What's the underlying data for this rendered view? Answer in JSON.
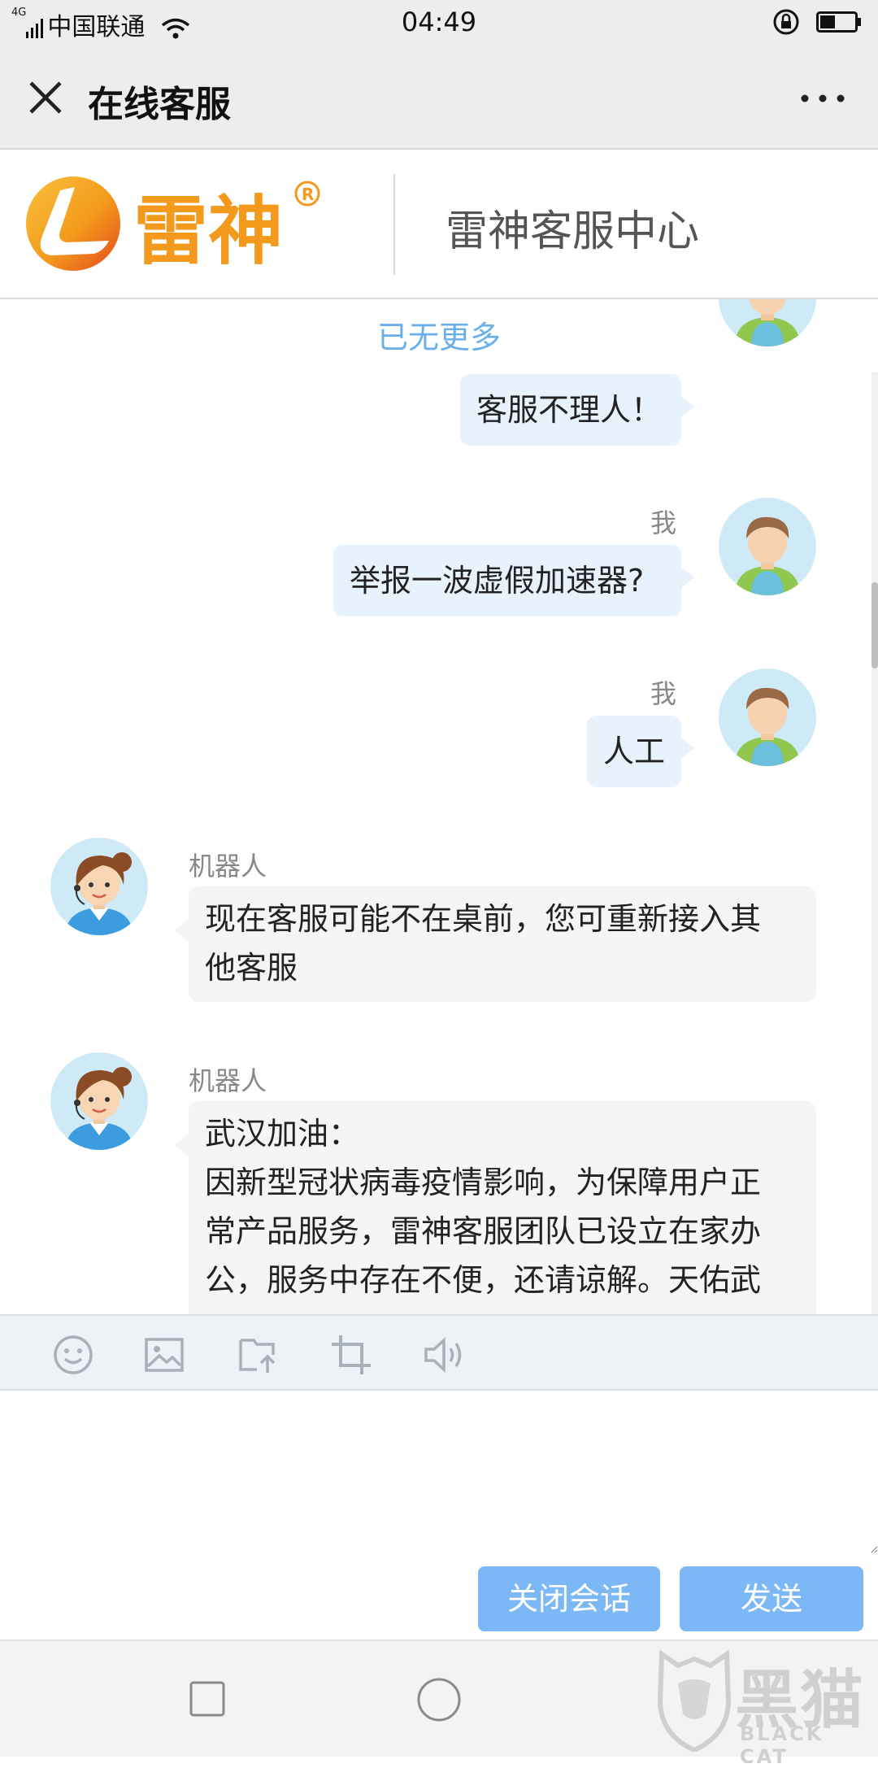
{
  "status_bar": {
    "network": "4G",
    "carrier": "中国联通",
    "time": "04:49",
    "icons": [
      "signal-icon",
      "wifi-icon",
      "rotation-lock-icon",
      "battery-icon"
    ]
  },
  "nav": {
    "title": "在线客服",
    "close_icon": "close-icon",
    "more_icon": "more-icon"
  },
  "brand": {
    "logo_text": "雷神",
    "registered_mark": "®",
    "service_title": "雷神客服中心",
    "colors": {
      "orange": "#f39a1c",
      "red": "#e5481e"
    }
  },
  "chat": {
    "no_more": "已无更多",
    "messages": [
      {
        "from": "me",
        "sender": "",
        "text": "客服不理人！"
      },
      {
        "from": "me",
        "sender": "我",
        "text": "举报一波虚假加速器?"
      },
      {
        "from": "me",
        "sender": "我",
        "text": "人工"
      },
      {
        "from": "bot",
        "sender": "机器人",
        "lines": [
          "现在客服可能不在桌前，您可重新接入其",
          "他客服"
        ]
      },
      {
        "from": "bot",
        "sender": "机器人",
        "lines": [
          "武汉加油：",
          "因新型冠状病毒疫情影响，为保障用户正",
          "常产品服务，雷神客服团队已设立在家办",
          "公，服务中存在不便，还请谅解。天佑武"
        ]
      }
    ]
  },
  "toolbar": {
    "tools": [
      "emoji-icon",
      "image-icon",
      "file-upload-icon",
      "crop-icon",
      "voice-icon"
    ]
  },
  "input": {
    "placeholder": "",
    "value": ""
  },
  "actions": {
    "close_session": "关闭会话",
    "send": "发送",
    "accent": "#7cb8f5"
  },
  "system_nav": {
    "icons": [
      "recent-apps-icon",
      "home-icon"
    ]
  },
  "watermark": {
    "cn": "黑猫",
    "en": "BLACK CAT"
  }
}
